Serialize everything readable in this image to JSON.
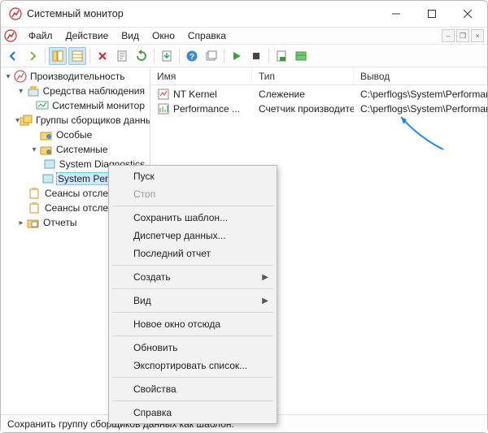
{
  "window": {
    "title": "Системный монитор"
  },
  "menus": {
    "file": "Файл",
    "action": "Действие",
    "view": "Вид",
    "window": "Окно",
    "help": "Справка"
  },
  "tree": {
    "root": "Производительность",
    "monitoring_tools": "Средства наблюдения",
    "perf_monitor": "Системный монитор",
    "collector_groups": "Группы сборщиков данных",
    "custom": "Особые",
    "system": "Системные",
    "sys_diag": "System Diagnostics",
    "sys_perf": "System Performance",
    "session_start": "Сеансы отслеживания событий",
    "session_autostart": "Сеансы отслеживания событий",
    "reports": "Отчеты"
  },
  "columns": {
    "name": "Имя",
    "type": "Тип",
    "output": "Вывод"
  },
  "rows": [
    {
      "name": "NT Kernel",
      "type": "Слежение",
      "output": "C:\\perflogs\\System\\Performance\\DN"
    },
    {
      "name": "Performance ...",
      "type": "Счетчик производите...",
      "output": "C:\\perflogs\\System\\Performance\\DN"
    }
  ],
  "context_menu": {
    "start": "Пуск",
    "stop": "Стоп",
    "save_template": "Сохранить шаблон...",
    "data_manager": "Диспетчер данных...",
    "last_report": "Последний отчет",
    "create": "Создать",
    "view": "Вид",
    "new_window": "Новое окно отсюда",
    "refresh": "Обновить",
    "export_list": "Экспортировать список...",
    "properties": "Свойства",
    "help": "Справка"
  },
  "status": {
    "text": "Сохранить группу сборщиков данных как шаблон."
  }
}
